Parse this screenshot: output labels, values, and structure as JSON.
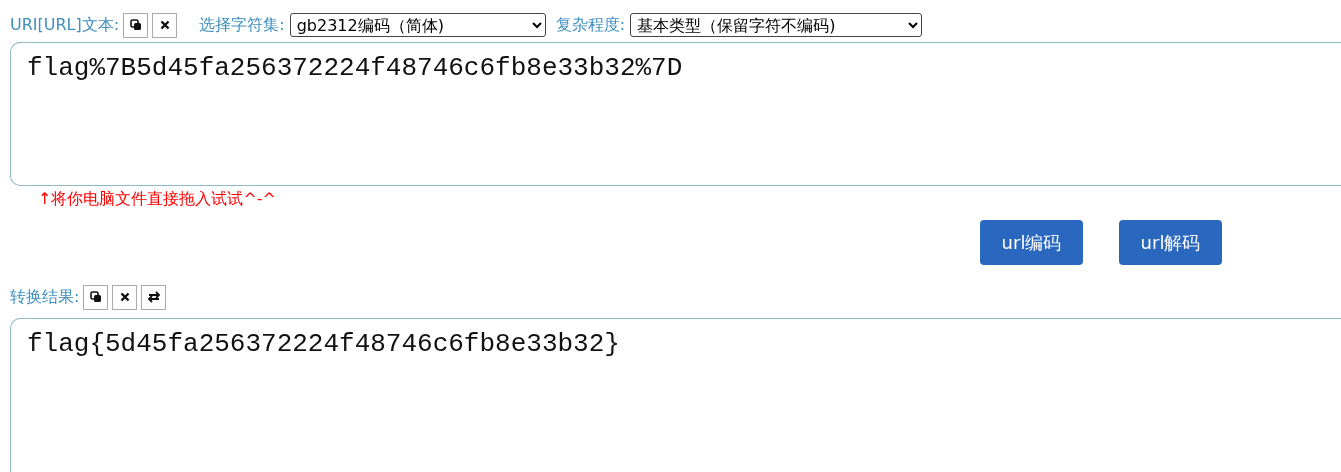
{
  "input_section": {
    "label": "URI[URL]文本:",
    "tools": [
      {
        "kind": "copy"
      },
      {
        "kind": "clear"
      }
    ],
    "charset": {
      "label": "选择字符集:",
      "value": "gb2312编码（简体)"
    },
    "complexity": {
      "label": "复杂程度:",
      "value": "基本类型（保留字符不编码)"
    },
    "value": "flag%7B5d45fa256372224f48746c6fb8e33b32%7D",
    "hint": "↑将你电脑文件直接拖入试试^-^"
  },
  "buttons": [
    "url编码",
    "url解码"
  ],
  "result_section": {
    "label": "转换结果:",
    "tools": [
      {
        "kind": "copy"
      },
      {
        "kind": "clear"
      },
      {
        "kind": "swap"
      }
    ],
    "value": "flag{5d45fa256372224f48746c6fb8e33b32}"
  }
}
